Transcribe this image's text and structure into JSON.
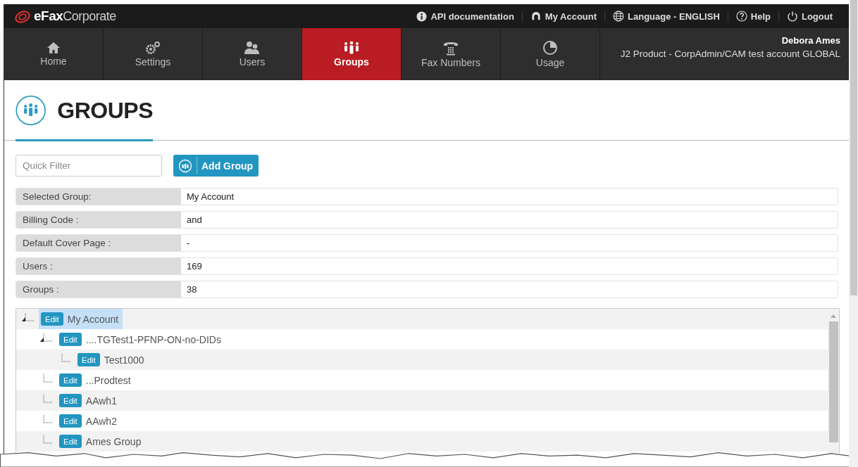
{
  "top_bar": {
    "logo_bold": "eFax",
    "logo_light": "Corporate",
    "links": [
      {
        "kind": "info",
        "label": "API documentation"
      },
      {
        "kind": "account",
        "label": "My Account"
      },
      {
        "kind": "globe",
        "label": "Language - ENGLISH"
      },
      {
        "kind": "help",
        "label": "Help"
      },
      {
        "kind": "power",
        "label": "Logout"
      }
    ]
  },
  "nav": {
    "items": [
      {
        "kind": "home",
        "label": "Home",
        "selected": false
      },
      {
        "kind": "settings",
        "label": "Settings",
        "selected": false
      },
      {
        "kind": "users",
        "label": "Users",
        "selected": false
      },
      {
        "kind": "groups",
        "label": "Groups",
        "selected": true
      },
      {
        "kind": "fax",
        "label": "Fax Numbers",
        "selected": false
      },
      {
        "kind": "usage",
        "label": "Usage",
        "selected": false
      }
    ],
    "user_name": "Debora Ames",
    "account": "J2 Product - CorpAdmin/CAM test account GLOBAL"
  },
  "page_title": "GROUPS",
  "filter": {
    "placeholder": "Quick Filter"
  },
  "add_button": "Add Group",
  "details": [
    {
      "label": "Selected Group:",
      "value": "My Account"
    },
    {
      "label": "Billing Code :",
      "value": "and"
    },
    {
      "label": "Default Cover Page :",
      "value": "-"
    },
    {
      "label": "Users :",
      "value": "169"
    },
    {
      "label": "Groups :",
      "value": "38"
    }
  ],
  "tree": [
    {
      "name": "My Account",
      "edit": "Edit",
      "selected": true,
      "expanded": true,
      "children": [
        {
          "name": "....TGTest1-PFNP-ON-no-DIDs",
          "edit": "Edit",
          "selected": false,
          "expanded": true,
          "children": [
            {
              "name": "Test1000",
              "edit": "Edit",
              "selected": false,
              "expanded": false
            }
          ]
        },
        {
          "name": "...Prodtest",
          "edit": "Edit",
          "selected": false,
          "expanded": false
        },
        {
          "name": "AAwh1",
          "edit": "Edit",
          "selected": false,
          "expanded": false
        },
        {
          "name": "AAwh2",
          "edit": "Edit",
          "selected": false,
          "expanded": false
        },
        {
          "name": "Ames Group",
          "edit": "Edit",
          "selected": false,
          "expanded": false
        }
      ]
    }
  ]
}
